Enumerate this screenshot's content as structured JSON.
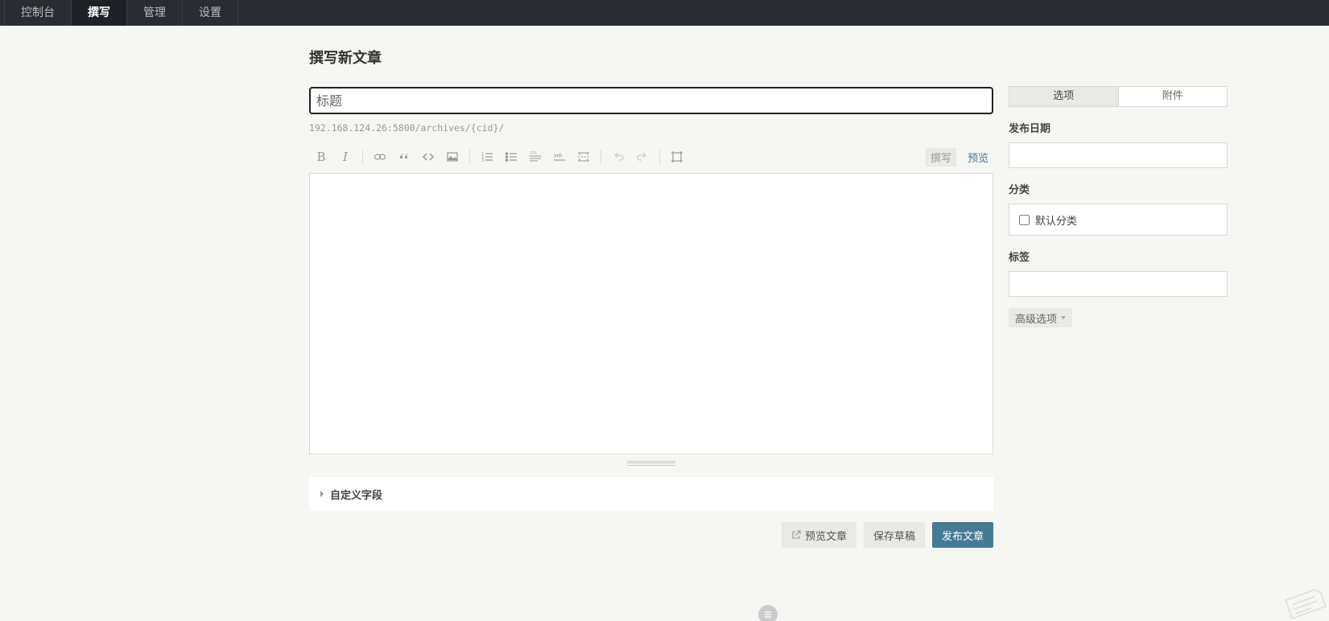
{
  "nav": {
    "items": [
      {
        "label": "控制台",
        "active": false
      },
      {
        "label": "撰写",
        "active": true
      },
      {
        "label": "管理",
        "active": false
      },
      {
        "label": "设置",
        "active": false
      }
    ]
  },
  "page": {
    "title": "撰写新文章"
  },
  "post": {
    "title_placeholder": "标题",
    "title_value": "",
    "permalink": "192.168.124.26:5800/archives/{cid}/"
  },
  "toolbar": {
    "icons": [
      "bold-icon",
      "italic-icon",
      "link-icon",
      "quote-icon",
      "code-icon",
      "image-icon",
      "ordered-list-icon",
      "unordered-list-icon",
      "heading-icon",
      "hr-icon",
      "more-icon",
      "undo-icon",
      "redo-icon",
      "fullscreen-icon"
    ],
    "bold_glyph": "B",
    "italic_glyph": "I",
    "mode_write": "撰写",
    "mode_preview": "预览"
  },
  "custom_fields": {
    "label": "自定义字段"
  },
  "actions": {
    "preview": "预览文章",
    "save_draft": "保存草稿",
    "publish": "发布文章"
  },
  "sidebar": {
    "tabs": [
      {
        "label": "选项",
        "active": true
      },
      {
        "label": "附件",
        "active": false
      }
    ],
    "publish_date_label": "发布日期",
    "publish_date_value": "",
    "category_label": "分类",
    "categories": [
      {
        "label": "默认分类",
        "checked": false
      }
    ],
    "tags_label": "标签",
    "tags_value": "",
    "advanced_label": "高级选项"
  },
  "colors": {
    "nav_bg": "#292d33",
    "page_bg": "#f6f6f3",
    "accent": "#467b96"
  }
}
